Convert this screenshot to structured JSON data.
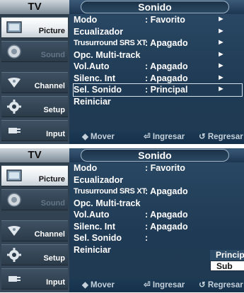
{
  "panels": [
    {
      "tv_title": "TV",
      "menu_title": "Sonido",
      "sidebar": [
        {
          "label": "Picture"
        },
        {
          "label": "Sound"
        },
        {
          "label": "Channel"
        },
        {
          "label": "Setup"
        },
        {
          "label": "Input"
        }
      ],
      "rows": [
        {
          "label": "Modo",
          "value": ": Favorito",
          "arrow": "►"
        },
        {
          "label": "Ecualizador",
          "value": "",
          "arrow": "►"
        },
        {
          "label": "Trusurround SRS XT",
          "value": ": Apagado",
          "arrow": "►"
        },
        {
          "label": "Opc. Multi-track",
          "value": "",
          "arrow": "►"
        },
        {
          "label": "Vol.Auto",
          "value": ": Apagado",
          "arrow": "►"
        },
        {
          "label": "Silenc. Int",
          "value": ": Apagado",
          "arrow": "►"
        },
        {
          "label": "Sel. Sonido",
          "value": ": Principal",
          "arrow": "►"
        },
        {
          "label": "Reiniciar",
          "value": "",
          "arrow": ""
        }
      ],
      "bottom": {
        "move": "◆ Mover",
        "enter": "⏎ Ingresar",
        "return": "↺ Regresar"
      }
    },
    {
      "tv_title": "TV",
      "menu_title": "Sonido",
      "sidebar": [
        {
          "label": "Picture"
        },
        {
          "label": "Sound"
        },
        {
          "label": "Channel"
        },
        {
          "label": "Setup"
        },
        {
          "label": "Input"
        }
      ],
      "rows": [
        {
          "label": "Modo",
          "value": ": Favorito"
        },
        {
          "label": "Ecualizador",
          "value": ""
        },
        {
          "label": "Trusurround SRS XT",
          "value": ": Apagado"
        },
        {
          "label": "Opc. Multi-track",
          "value": ""
        },
        {
          "label": "Vol.Auto",
          "value": ": Apagado"
        },
        {
          "label": "Silenc. Int",
          "value": ": Apagado"
        },
        {
          "label": "Sel. Sonido",
          "value": ":"
        },
        {
          "label": "Reiniciar",
          "value": ""
        }
      ],
      "dropdown": {
        "options": [
          "Principal",
          "Sub"
        ],
        "selected": "Sub"
      },
      "bottom": {
        "move": "◆ Mover",
        "enter": "⏎ Ingresar",
        "return": "↺ Regresar"
      }
    }
  ],
  "icons": {
    "picture": "picture-icon",
    "sound": "speaker-icon",
    "channel": "satellite-dish-icon",
    "setup": "gear-icon",
    "input": "plug-icon"
  },
  "colors": {
    "sidebar_active": "#ffffff",
    "menu_bg": "#1f3a54",
    "text": "#ffffff",
    "dim_text": "#63778a"
  }
}
